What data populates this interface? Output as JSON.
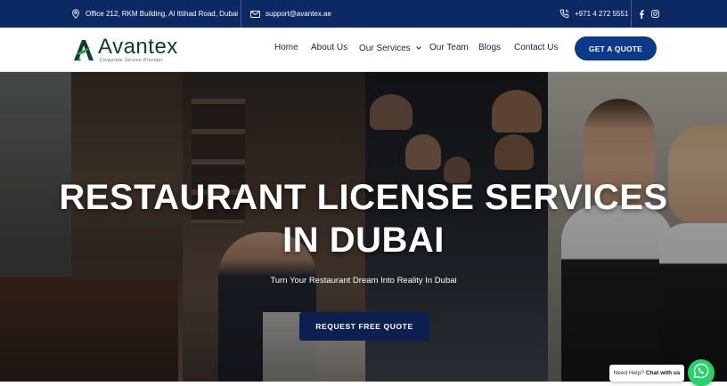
{
  "topbar": {
    "address": "Office 212, RKM Building, Al Ittihad Road, Dubai",
    "email": "support@avantex.ae",
    "phone": "+971 4 272 5551",
    "social": [
      "facebook-icon",
      "instagram-icon"
    ]
  },
  "brand": {
    "name": "Avantex",
    "tagline": "Corporate Service Provider",
    "accent": "#0b3a8a",
    "topbar_bg": "#0b2a63",
    "logo_green": "#0c3f2b"
  },
  "nav": {
    "items": [
      {
        "label": "Home"
      },
      {
        "label": "About Us"
      },
      {
        "label": "Our Services",
        "has_dropdown": true
      },
      {
        "label": "Our Team"
      },
      {
        "label": "Blogs"
      },
      {
        "label": "Contact Us"
      }
    ],
    "cta": "GET A QUOTE"
  },
  "hero": {
    "title_line1": "RESTAURANT LICENSE SERVICES",
    "title_line2": "IN DUBAI",
    "subtitle": "Turn Your Restaurant Dream Into Reality In Dubai",
    "button": "REQUEST FREE QUOTE"
  },
  "whatsapp": {
    "prefix": "Need Help?",
    "action": "Chat with us",
    "color": "#25d366"
  }
}
